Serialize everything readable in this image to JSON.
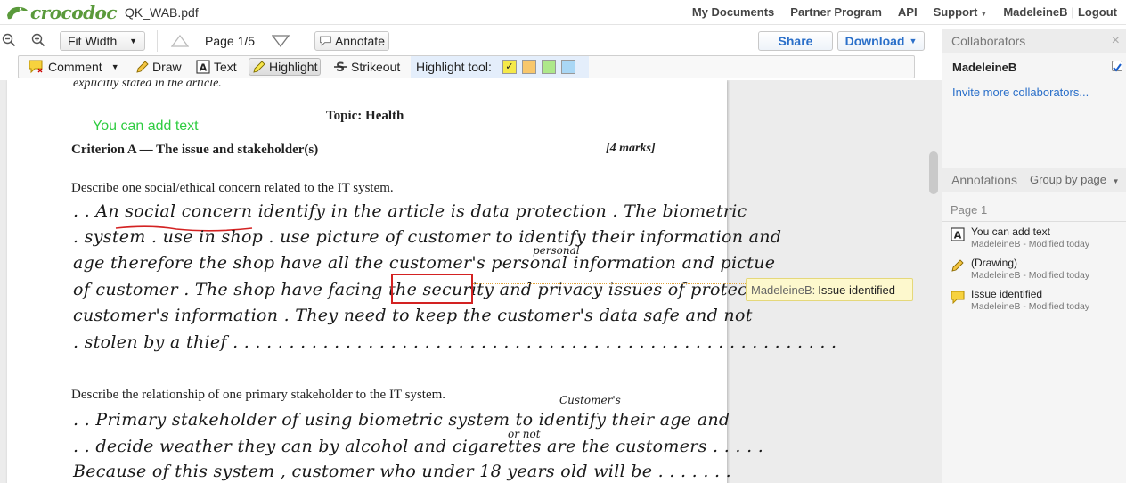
{
  "topbar": {
    "logo_text": "crocodoc",
    "doc_title": "QK_WAB.pdf",
    "nav": {
      "my_documents": "My Documents",
      "partner_program": "Partner Program",
      "api": "API",
      "support": "Support",
      "user": "MadeleineB",
      "separator": "|",
      "logout": "Logout"
    }
  },
  "toolbar": {
    "zoom_select": "Fit Width",
    "page_indicator": "Page 1/5",
    "annotate": "Annotate",
    "share": "Share",
    "download": "Download"
  },
  "annotate_toolbar": {
    "comment": "Comment",
    "draw": "Draw",
    "text": "Text",
    "highlight": "Highlight",
    "strikeout": "Strikeout",
    "highlight_tool_label": "Highlight tool:",
    "swatches": [
      "#f5e94a",
      "#f8c76b",
      "#aee88a",
      "#a9d7f5"
    ]
  },
  "document": {
    "line_top": "explicitly stated in the article.",
    "added_text": "You can add text",
    "topic": "Topic: Health",
    "criterion": "Criterion A — The issue and stakeholder(s)",
    "marks": "[4 marks]",
    "q1": "Describe one social/ethical concern related to the IT system.",
    "hw1": ". . An  social  concern  identify  in  the  article  is  data  protection .  The  biometric",
    "hw2": ". system . use in shop . use  picture  of  customer  to  identify  their information  and",
    "hw3": "age  therefore  the  shop  have  all  the  customer's  personal  information  and  pictue",
    "hw3_insert": "personal",
    "hw4": "of  customer .  The  shop  have  facing  the  security  and  privacy  issues  of  protecting",
    "hw5": "customer's  information .  They  need  to  keep  the  customer's  data  safe  and  not",
    "hw6": ". stolen  by  a thief  . . . . . . . . . . . . . . . . . . . . . . . . . . . . . . . . . . . . . . . . . . . . . . . . . . . . . .",
    "q2": "Describe the relationship of one primary stakeholder to the IT system.",
    "hw7": ". . Primary  stakeholder  of  using  biometric  system  to  identify  their  age  and",
    "hw7_insert": "Customer's",
    "hw8": ". . decide  weather  they  can  by  alcohol  and  cigarettes  are  the  customers . . . . .",
    "hw8_insert": "or not",
    "hw9": "  Because  of  this  system ,  customer  who  under  18  years  old  will  be . . . . . . ."
  },
  "callout": {
    "author": "MadeleineB:",
    "message": "Issue identified"
  },
  "sidebar": {
    "collaborators_title": "Collaborators",
    "close": "×",
    "collaborator": "MadeleineB",
    "invite": "Invite more collaborators...",
    "annotations_title": "Annotations",
    "group_by": "Group by page",
    "page_label": "Page 1",
    "annotations": [
      {
        "title": "You can add text",
        "meta": "MadeleineB - Modified today",
        "icon": "text-icon"
      },
      {
        "title": "(Drawing)",
        "meta": "MadeleineB - Modified today",
        "icon": "pencil-icon"
      },
      {
        "title": "Issue identified",
        "meta": "MadeleineB - Modified today",
        "icon": "comment-icon"
      }
    ]
  }
}
